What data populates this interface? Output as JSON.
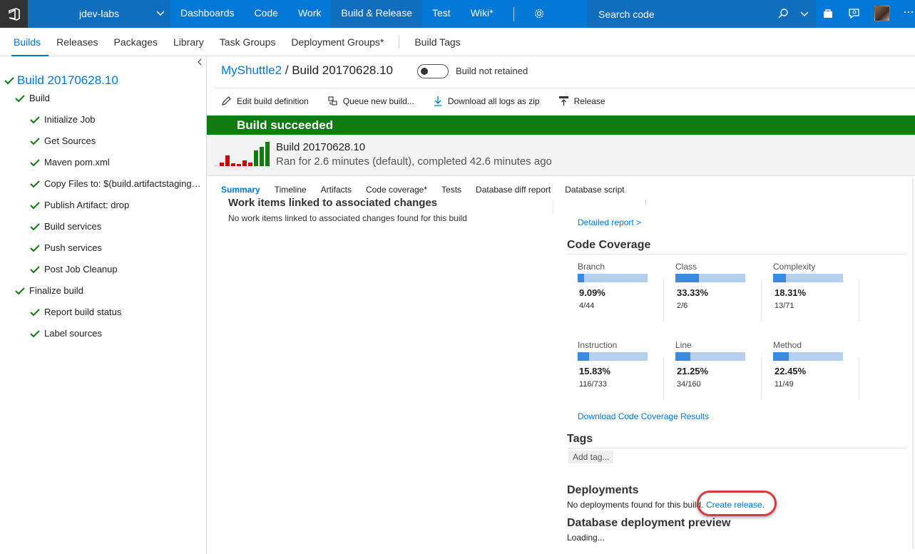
{
  "topbar": {
    "project": "jdev-labs",
    "nav": [
      "Dashboards",
      "Code",
      "Work",
      "Build & Release",
      "Test",
      "Wiki*"
    ],
    "active_nav": "Build & Release",
    "search_placeholder": "Search code",
    "accent": "#0078d7"
  },
  "subnav": {
    "items": [
      "Builds",
      "Releases",
      "Packages",
      "Library",
      "Task Groups",
      "Deployment Groups*"
    ],
    "extra": "Build Tags",
    "active": "Builds"
  },
  "tree": {
    "title": "Build 20170628.10",
    "items": [
      {
        "label": "Build",
        "level": 1
      },
      {
        "label": "Initialize Job",
        "level": 2
      },
      {
        "label": "Get Sources",
        "level": 2
      },
      {
        "label": "Maven pom.xml",
        "level": 2
      },
      {
        "label": "Copy Files to: $(build.artifactstaging…",
        "level": 2
      },
      {
        "label": "Publish Artifact: drop",
        "level": 2
      },
      {
        "label": "Build services",
        "level": 2
      },
      {
        "label": "Push services",
        "level": 2
      },
      {
        "label": "Post Job Cleanup",
        "level": 2
      },
      {
        "label": "Finalize build",
        "level": 1
      },
      {
        "label": "Report build status",
        "level": 2
      },
      {
        "label": "Label sources",
        "level": 2
      }
    ],
    "check_color": "#107c10"
  },
  "header": {
    "project": "MyShuttle2",
    "separator": " / ",
    "build": "Build 20170628.10",
    "retain_label": "Build not retained"
  },
  "toolbar": {
    "edit": "Edit build definition",
    "queue": "Queue new build...",
    "download": "Download all logs as zip",
    "release": "Release"
  },
  "banner": {
    "text": "Build succeeded",
    "color": "#107c10"
  },
  "summary": {
    "title": "Build 20170628.10",
    "subtitle": "Ran for 2.6 minutes (default), completed 42.6 minutes ago"
  },
  "tabs": [
    "Summary",
    "Timeline",
    "Artifacts",
    "Code coverage*",
    "Tests",
    "Database diff report",
    "Database script"
  ],
  "active_tab": "Summary",
  "work_items": {
    "title": "Work items linked to associated changes",
    "empty": "No work items linked to associated changes found for this build"
  },
  "detailed_report": "Detailed report >",
  "coverage": {
    "title": "Code Coverage",
    "metrics": [
      {
        "name": "Branch",
        "percent": "9.09%",
        "fraction": "4/44",
        "value": 0.0909
      },
      {
        "name": "Class",
        "percent": "33.33%",
        "fraction": "2/6",
        "value": 0.3333
      },
      {
        "name": "Complexity",
        "percent": "18.31%",
        "fraction": "13/71",
        "value": 0.1831
      },
      {
        "name": "Instruction",
        "percent": "15.83%",
        "fraction": "116/733",
        "value": 0.1583
      },
      {
        "name": "Line",
        "percent": "21.25%",
        "fraction": "34/160",
        "value": 0.2125
      },
      {
        "name": "Method",
        "percent": "22.45%",
        "fraction": "11/49",
        "value": 0.2245
      }
    ],
    "download": "Download Code Coverage Results"
  },
  "tags": {
    "title": "Tags",
    "add": "Add tag..."
  },
  "deployments": {
    "title": "Deployments",
    "empty": "No deployments found for this build.",
    "create": "Create release."
  },
  "db_preview": {
    "title": "Database deployment preview",
    "loading": "Loading..."
  }
}
